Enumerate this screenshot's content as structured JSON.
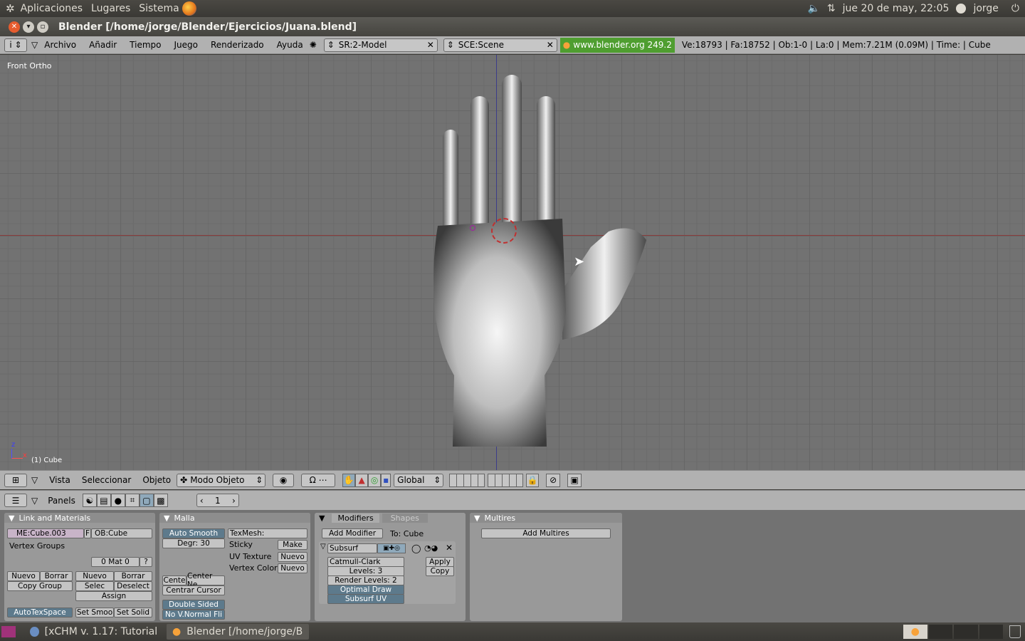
{
  "top_panel": {
    "menus": [
      "Aplicaciones",
      "Lugares",
      "Sistema"
    ],
    "clock": "jue 20 de may, 22:05",
    "user": "jorge"
  },
  "window": {
    "title": "Blender [/home/jorge/Blender/Ejercicios/Juana.blend]"
  },
  "header": {
    "menus": [
      "Archivo",
      "Añadir",
      "Tiempo",
      "Juego",
      "Renderizado",
      "Ayuda"
    ],
    "screen_field": "SR:2-Model",
    "scene_field": "SCE:Scene",
    "version": "www.blender.org 249.2",
    "stats": "Ve:18793 | Fa:18752 | Ob:1-0 | La:0  | Mem:7.21M (0.09M)  | Time: | Cube"
  },
  "viewport": {
    "view_name": "Front Ortho",
    "object_label": "(1) Cube",
    "axis_z": "z",
    "axis_x": "x"
  },
  "view3d_toolbar": {
    "menus": [
      "Vista",
      "Seleccionar",
      "Objeto"
    ],
    "mode": "Modo Objeto",
    "orientation": "Global"
  },
  "buttons_toolbar": {
    "panels_label": "Panels",
    "frame": "1"
  },
  "link_materials": {
    "title": "Link and Materials",
    "mesh_name": "ME:Cube.003",
    "f_label": "F",
    "object_name": "OB:Cube",
    "vertex_groups": "Vertex Groups",
    "mat_field": "0 Mat 0",
    "question": "?",
    "new": "Nuevo",
    "delete": "Borrar",
    "copy_group": "Copy Group",
    "select": "Selec",
    "deselect": "Deselect",
    "assign": "Assign",
    "autotexspace": "AutoTexSpace",
    "set_smooth": "Set Smoo",
    "set_solid": "Set Solid"
  },
  "mesh": {
    "title": "Malla",
    "auto_smooth": "Auto Smooth",
    "degr": "Degr: 30",
    "texmesh": "TexMesh:",
    "sticky": "Sticky",
    "make": "Make",
    "uv_texture": "UV Texture",
    "vertex_color": "Vertex Color",
    "new": "Nuevo",
    "centre": "Cente",
    "center_new": "Center Ne",
    "center_cursor": "Centrar Cursor",
    "double_sided": "Double Sided",
    "no_vnormal": "No V.Normal Fli"
  },
  "modifiers": {
    "tab_modifiers": "Modifiers",
    "tab_shapes": "Shapes",
    "add_modifier": "Add Modifier",
    "to": "To: Cube",
    "subsurf": "Subsurf",
    "catmull": "Catmull-Clark",
    "levels": "Levels: 3",
    "render_levels": "Render Levels: 2",
    "optimal": "Optimal Draw",
    "subsurf_uv": "Subsurf UV",
    "apply": "Apply",
    "copy": "Copy"
  },
  "multires": {
    "title": "Multires",
    "add": "Add Multires"
  },
  "taskbar": {
    "tasks": [
      "[xCHM v. 1.17: Tutorial ...",
      "Blender [/home/jorge/Bl..."
    ]
  }
}
